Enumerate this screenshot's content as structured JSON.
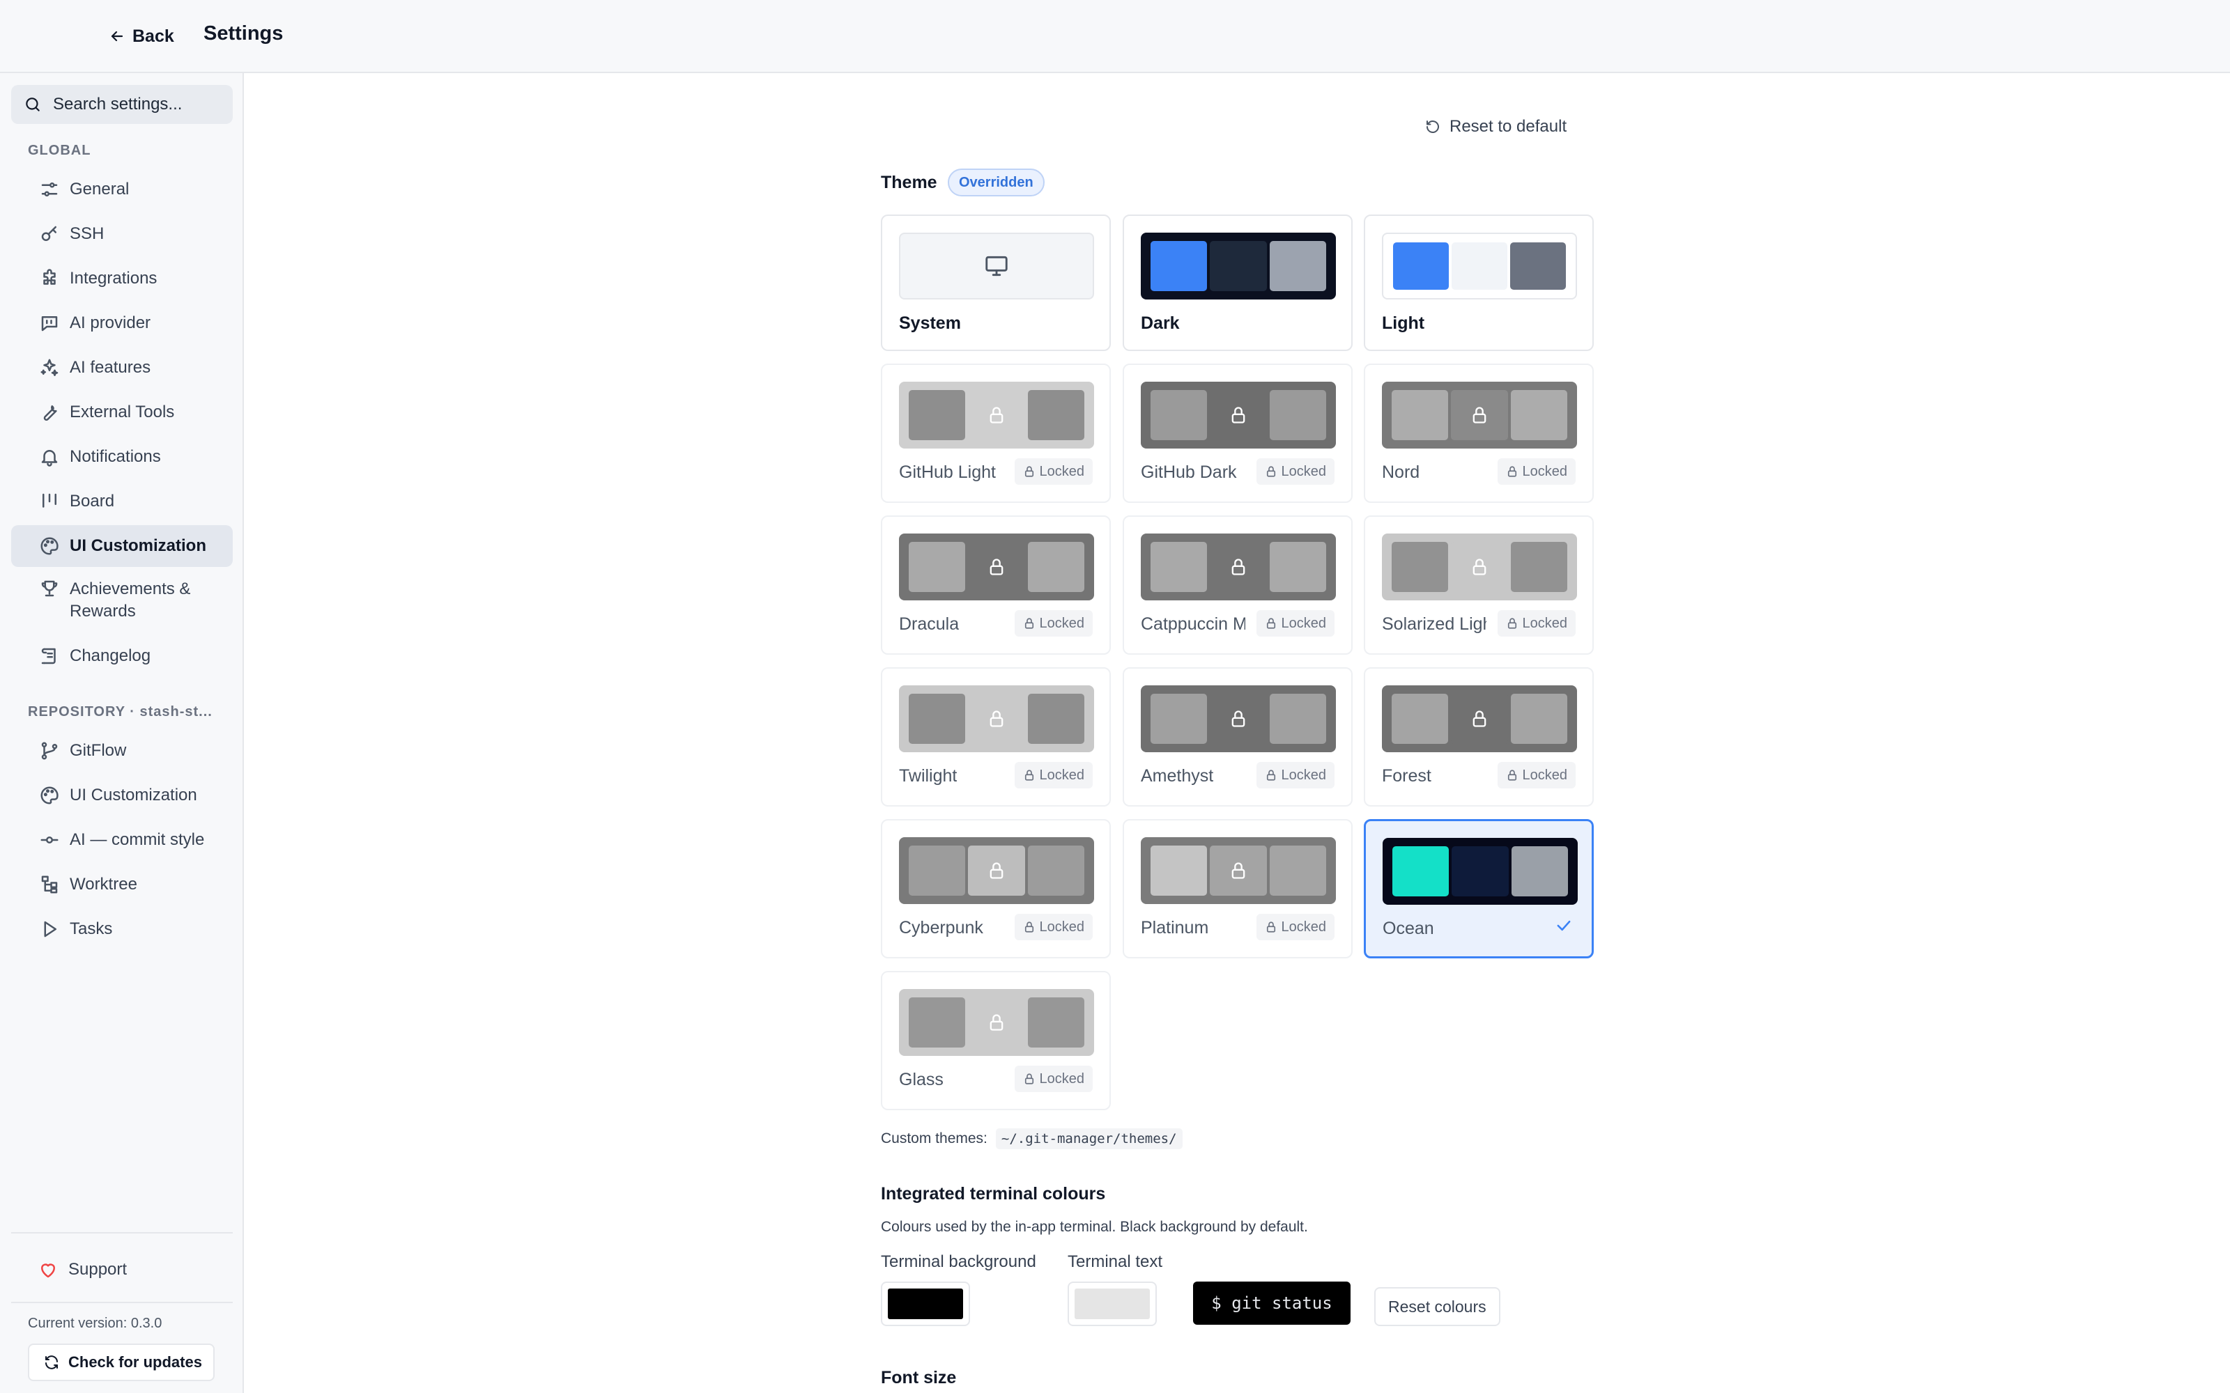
{
  "header": {
    "back_label": "Back",
    "title": "Settings"
  },
  "sidebar": {
    "search_placeholder": "Search settings...",
    "global_label": "GLOBAL",
    "global_items": [
      {
        "label": "General",
        "icon": "sliders-icon"
      },
      {
        "label": "SSH",
        "icon": "key-icon"
      },
      {
        "label": "Integrations",
        "icon": "puzzle-icon"
      },
      {
        "label": "AI provider",
        "icon": "chat-icon"
      },
      {
        "label": "AI features",
        "icon": "sparkles-icon"
      },
      {
        "label": "External Tools",
        "icon": "wrench-icon"
      },
      {
        "label": "Notifications",
        "icon": "bell-icon"
      },
      {
        "label": "Board",
        "icon": "board-icon"
      },
      {
        "label": "UI Customization",
        "icon": "palette-icon",
        "active": true
      },
      {
        "label": "Achievements & Rewards",
        "icon": "trophy-icon"
      },
      {
        "label": "Changelog",
        "icon": "scroll-icon"
      }
    ],
    "repository_label": "REPOSITORY · stash-st...",
    "repository_items": [
      {
        "label": "GitFlow",
        "icon": "git-branch-icon"
      },
      {
        "label": "UI Customization",
        "icon": "palette-icon"
      },
      {
        "label": "AI — commit style",
        "icon": "git-commit-icon"
      },
      {
        "label": "Worktree",
        "icon": "worktree-icon"
      },
      {
        "label": "Tasks",
        "icon": "play-icon"
      }
    ],
    "support_label": "Support",
    "version_text": "Current version: 0.3.0",
    "check_updates_label": "Check for updates"
  },
  "main": {
    "reset_default_label": "Reset to default",
    "theme_label": "Theme",
    "theme_badge": "Overridden",
    "locked_label": "Locked",
    "themes": [
      {
        "name": "System",
        "locked": false,
        "kind": "system"
      },
      {
        "name": "Dark",
        "locked": false,
        "colors": [
          "#3b82f6",
          "#1e293b",
          "#9ca3af"
        ],
        "frame": "#0b1020"
      },
      {
        "name": "Light",
        "locked": false,
        "colors": [
          "#3b82f6",
          "#f1f4f8",
          "#6b7280"
        ],
        "frame": "#ffffff"
      },
      {
        "name": "GitHub Light",
        "locked": true
      },
      {
        "name": "GitHub Dark",
        "locked": true
      },
      {
        "name": "Nord",
        "locked": true
      },
      {
        "name": "Dracula",
        "locked": true
      },
      {
        "name": "Catppuccin Mocha",
        "locked": true
      },
      {
        "name": "Solarized Light",
        "locked": true
      },
      {
        "name": "Twilight",
        "locked": true
      },
      {
        "name": "Amethyst",
        "locked": true
      },
      {
        "name": "Forest",
        "locked": true
      },
      {
        "name": "Cyberpunk",
        "locked": true
      },
      {
        "name": "Platinum",
        "locked": true
      },
      {
        "name": "Ocean",
        "locked": false,
        "selected": true,
        "colors": [
          "#14e0c8",
          "#0e1b3a",
          "#9aa0a8"
        ],
        "frame": "#06091a"
      },
      {
        "name": "Glass",
        "locked": true
      }
    ],
    "custom_themes_label": "Custom themes:",
    "custom_themes_path": "~/.git-manager/themes/",
    "terminal": {
      "heading": "Integrated terminal colours",
      "description": "Colours used by the in-app terminal. Black background by default.",
      "bg_label": "Terminal background",
      "text_label": "Terminal text",
      "bg_color": "#000000",
      "text_color": "#e5e5e5",
      "preview_text": "$ git status",
      "reset_label": "Reset colours"
    },
    "font_size_heading": "Font size"
  }
}
